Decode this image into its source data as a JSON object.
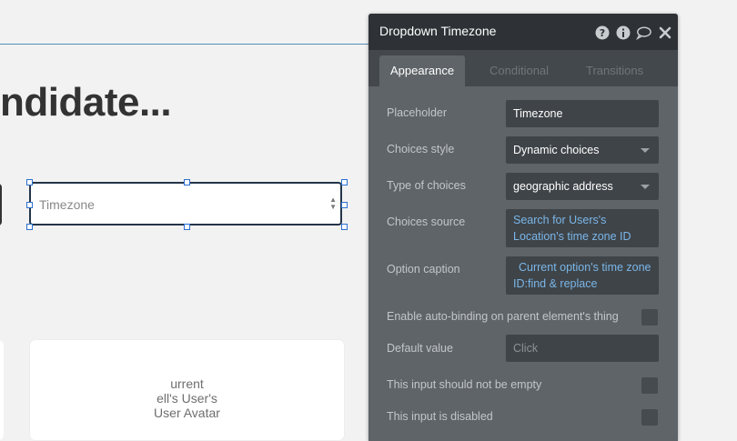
{
  "canvas": {
    "heading": "ndidate...",
    "dropdown_placeholder": "Timezone",
    "avatar_text": "urrent\nell's User's\nUser Avatar"
  },
  "panel": {
    "title": "Dropdown Timezone",
    "header_icons": [
      "help-icon",
      "info-icon",
      "comment-icon",
      "close-icon"
    ],
    "tabs": [
      {
        "label": "Appearance",
        "active": true
      },
      {
        "label": "Conditional",
        "active": false
      },
      {
        "label": "Transitions",
        "active": false
      }
    ],
    "rows": {
      "placeholder": {
        "label": "Placeholder",
        "value": "Timezone"
      },
      "choices_style": {
        "label": "Choices style",
        "value": "Dynamic choices"
      },
      "type_of_choices": {
        "label": "Type of choices",
        "value": "geographic address"
      },
      "choices_source": {
        "label": "Choices source",
        "value": "Search for Users's Location's time zone ID"
      },
      "option_caption": {
        "label": "Option caption",
        "value": "Current option's time zone ID:find & replace"
      },
      "auto_binding": {
        "label": "Enable auto-binding on parent element's thing"
      },
      "default_value": {
        "label": "Default value",
        "placeholder": "Click"
      },
      "not_empty": {
        "label": "This input should not be empty"
      },
      "disabled": {
        "label": "This input is disabled"
      }
    }
  },
  "colors": {
    "panel_bg": "#5e6468",
    "panel_header": "#2e3236",
    "link_blue": "#7ab6e9",
    "selection_blue": "#2a6fd1"
  }
}
